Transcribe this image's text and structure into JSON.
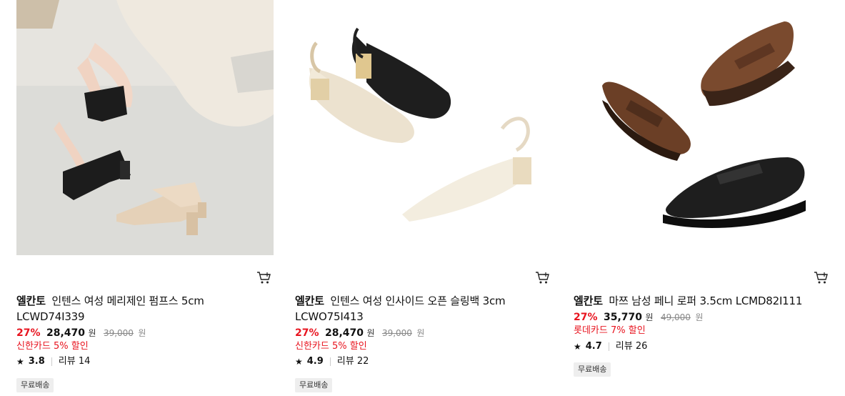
{
  "products": [
    {
      "brand": "엘칸토",
      "name": "인텐스 여성 메리제인 펌프스 5cm LCWD74I339",
      "discount": "27%",
      "price": "28,470",
      "price_unit": "원",
      "original_price": "39,000",
      "original_unit": "원",
      "card_promo": "신한카드 5% 할인",
      "rating": "3.8",
      "reviews": "리뷰 14",
      "badge": "무료배송",
      "image_icon": "mary-jane-pumps-photo"
    },
    {
      "brand": "엘칸토",
      "name": "인텐스 여성 인사이드 오픈 슬링백 3cm LCWO75I413",
      "discount": "27%",
      "price": "28,470",
      "price_unit": "원",
      "original_price": "39,000",
      "original_unit": "원",
      "card_promo": "신한카드 5% 할인",
      "rating": "4.9",
      "reviews": "리뷰 22",
      "badge": "무료배송",
      "image_icon": "slingback-shoes-photo"
    },
    {
      "brand": "엘칸토",
      "name": "마쯔 남성 페니 로퍼 3.5cm LCMD82I111",
      "discount": "27%",
      "price": "35,770",
      "price_unit": "원",
      "original_price": "49,000",
      "original_unit": "원",
      "card_promo": "롯데카드 7% 할인",
      "rating": "4.7",
      "reviews": "리뷰 26",
      "badge": "무료배송",
      "image_icon": "penny-loafers-photo"
    }
  ],
  "icons": {
    "cart": "cart-icon",
    "star": "star-icon"
  },
  "colors": {
    "discount": "#e8141f",
    "promo": "#e8141f",
    "badge_bg": "#eeeeee"
  }
}
